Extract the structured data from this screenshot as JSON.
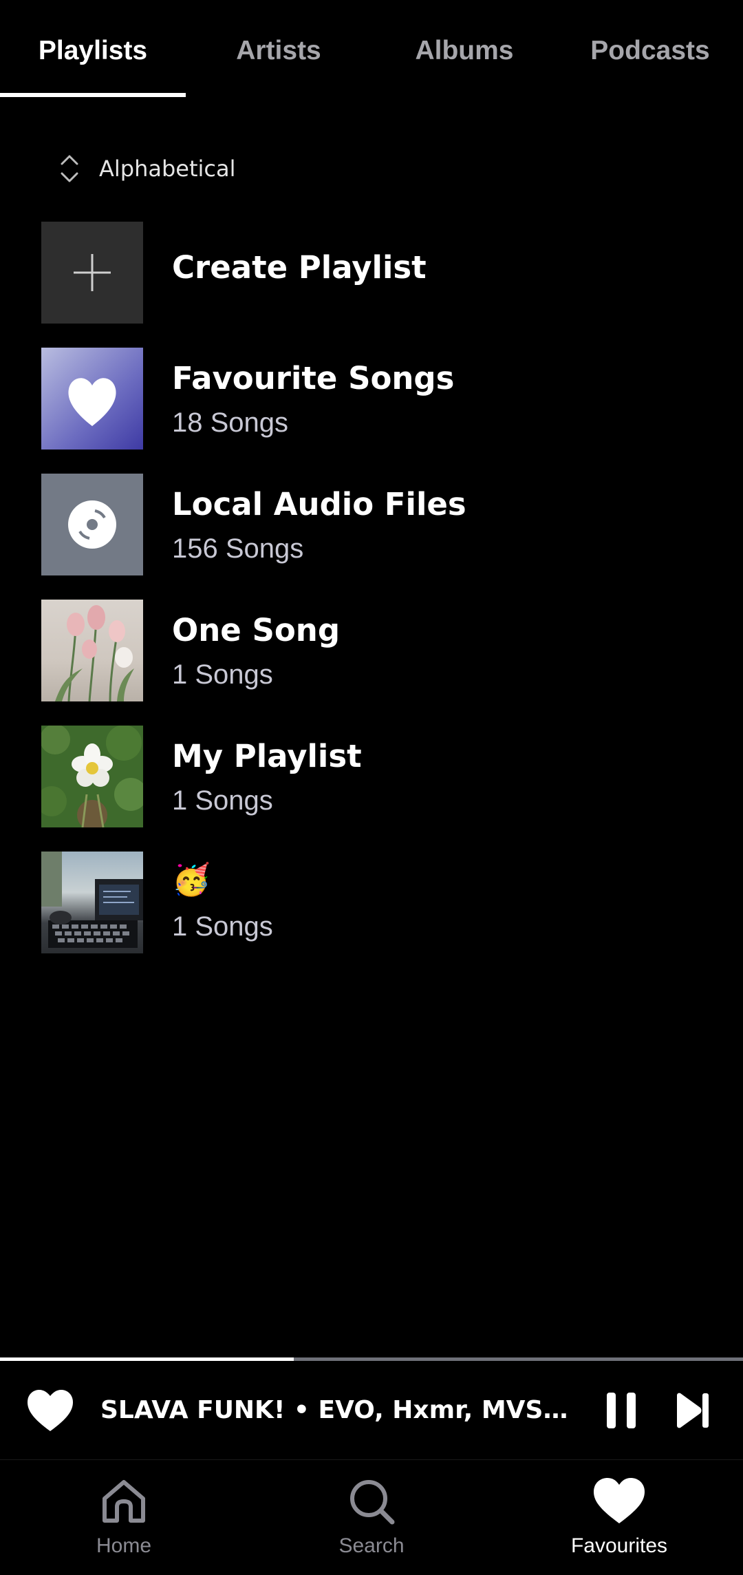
{
  "tabs": [
    {
      "label": "Playlists",
      "active": true
    },
    {
      "label": "Artists",
      "active": false
    },
    {
      "label": "Albums",
      "active": false
    },
    {
      "label": "Podcasts",
      "active": false
    }
  ],
  "sort": {
    "label": "Alphabetical",
    "icon": "sort-icon"
  },
  "playlists": [
    {
      "title": "Create Playlist",
      "subtitle": "",
      "icon": "plus-icon"
    },
    {
      "title": "Favourite Songs",
      "subtitle": "18 Songs",
      "icon": "heart-icon"
    },
    {
      "title": "Local Audio Files",
      "subtitle": "156 Songs",
      "icon": "disc-icon"
    },
    {
      "title": "One Song",
      "subtitle": "1 Songs",
      "icon": "tulips-cover"
    },
    {
      "title": "My Playlist",
      "subtitle": "1 Songs",
      "icon": "flower-cover"
    },
    {
      "title": "🥳",
      "subtitle": "1 Songs",
      "icon": "desk-cover"
    }
  ],
  "player": {
    "title": "SLAVA FUNK!  •  EVO, Hxmr, MVSTERI…",
    "progress": 0.395,
    "liked": true
  },
  "nav": [
    {
      "label": "Home",
      "icon": "home-icon",
      "active": false
    },
    {
      "label": "Search",
      "icon": "search-icon",
      "active": false
    },
    {
      "label": "Favourites",
      "icon": "heart-icon",
      "active": true
    }
  ],
  "colors": {
    "background": "#000000",
    "inactive": "#8b8b93",
    "progress_track": "#6e7078"
  }
}
